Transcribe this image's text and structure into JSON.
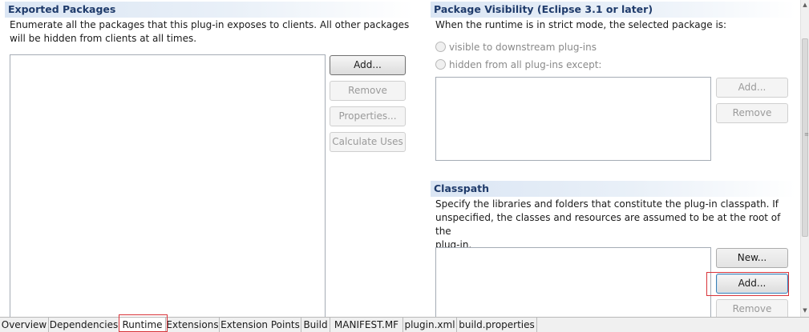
{
  "exported_packages": {
    "title": "Exported Packages",
    "description_1": "Enumerate all the packages that this plug-in exposes to clients.  All other packages",
    "description_2": "will be hidden from clients at all times.",
    "add_label": "Add...",
    "remove_label": "Remove",
    "properties_label": "Properties...",
    "calculate_uses_label": "Calculate Uses"
  },
  "package_visibility": {
    "title": "Package Visibility (Eclipse 3.1 or later)",
    "description": "When the runtime is in strict mode, the selected package is:",
    "option_visible": "visible to downstream plug-ins",
    "option_hidden": "hidden from all plug-ins except:",
    "add_label": "Add...",
    "remove_label": "Remove"
  },
  "classpath": {
    "title": "Classpath",
    "description_1": "Specify the libraries and folders that constitute the plug-in classpath.  If",
    "description_2": "unspecified, the classes and resources are assumed to be at the root of the",
    "description_3": "plug-in.",
    "new_label": "New...",
    "add_label": "Add...",
    "remove_label": "Remove"
  },
  "tabs": [
    "Overview",
    "Dependencies",
    "Runtime",
    "Extensions",
    "Extension Points",
    "Build",
    "MANIFEST.MF",
    "plugin.xml",
    "build.properties"
  ],
  "active_tab": "Runtime",
  "colors": {
    "section_title": "#1f3b6b",
    "highlight": "#d9343a"
  }
}
